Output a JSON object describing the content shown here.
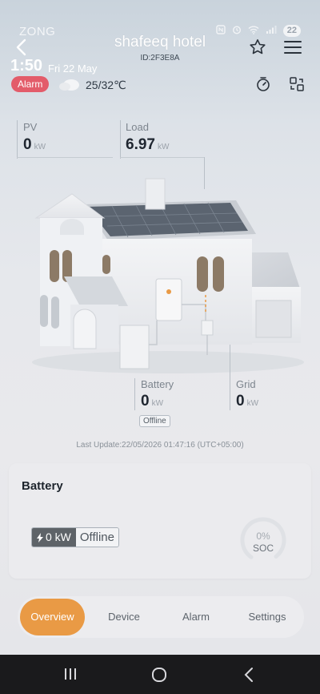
{
  "status_bar": {
    "carrier": "ZONG",
    "battery_level": "22"
  },
  "header": {
    "title": "shafeeq hotel",
    "device_id": "ID:2F3E8A"
  },
  "info": {
    "time": "1:50",
    "date": "Fri 22 May",
    "alarm_label": "Alarm",
    "temperature": "25/32℃"
  },
  "energy_flow": {
    "pv": {
      "label": "PV",
      "value": "0",
      "unit": "kW"
    },
    "load": {
      "label": "Load",
      "value": "6.97",
      "unit": "kW"
    },
    "battery": {
      "label": "Battery",
      "value": "0",
      "unit": "kW",
      "status": "Offline"
    },
    "grid": {
      "label": "Grid",
      "value": "0",
      "unit": "kW"
    }
  },
  "last_update": "Last Update:22/05/2026 01:47:16 (UTC+05:00)",
  "battery_card": {
    "title": "Battery",
    "power": "0 kW",
    "status": "Offline",
    "soc_percent": "0%",
    "soc_label": "SOC"
  },
  "tabs": [
    {
      "label": "Overview",
      "active": true
    },
    {
      "label": "Device",
      "active": false
    },
    {
      "label": "Alarm",
      "active": false
    },
    {
      "label": "Settings",
      "active": false
    }
  ],
  "colors": {
    "accent": "#e99a45",
    "alarm": "#e35c6a"
  }
}
